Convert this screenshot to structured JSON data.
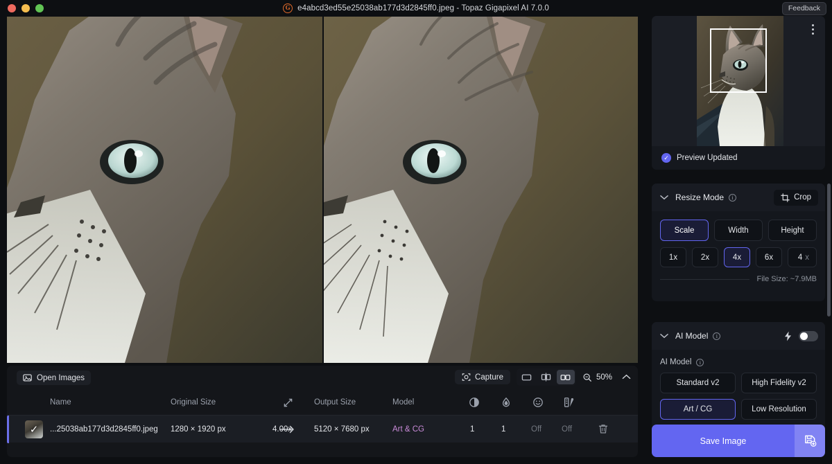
{
  "titlebar": {
    "filename": "e4abcd3ed55e25038ab177d3d2845ff0.jpeg",
    "title": "e4abcd3ed55e25038ab177d3d2845ff0.jpeg - Topaz Gigapixel AI 7.0.0",
    "app_logo": "G",
    "feedback_label": "Feedback",
    "traffic_lights": [
      "close-red",
      "minimize-yellow",
      "maximize-green"
    ]
  },
  "viewer": {
    "split_view": true,
    "left_pane": "original-preview",
    "right_pane": "upscaled-preview"
  },
  "bottom_toolbar": {
    "open_images_label": "Open Images",
    "capture_label": "Capture",
    "view_modes": [
      {
        "name": "single-view",
        "active": false
      },
      {
        "name": "split-view",
        "active": false
      },
      {
        "name": "side-by-side-view",
        "active": true
      }
    ],
    "zoom_level": "50%",
    "collapse_icon": "chevron-up-icon"
  },
  "table": {
    "columns": [
      "Name",
      "Original Size",
      "",
      "Output Size",
      "Model",
      "",
      "",
      "",
      ""
    ],
    "icon_columns": [
      "contrast-icon",
      "water-drop-icon",
      "face-recovery-icon",
      "color-palette-icon"
    ],
    "arrow_icon": "expand-arrow-icon",
    "rows": [
      {
        "selected": true,
        "checked": true,
        "name": "...25038ab177d3d2845ff0.jpeg",
        "original_size": "1280 × 1920 px",
        "scale": "4.00x",
        "output_size": "5120 × 7680 px",
        "model": "Art & CG",
        "contrast": "1",
        "denoise": "1",
        "face_recovery": "Off",
        "color": "Off",
        "delete_icon": "trash-icon"
      }
    ]
  },
  "preview_panel": {
    "status": "Preview Updated",
    "status_icon": "check-circle-icon",
    "menu_icon": "kebab-menu-icon",
    "crop_selection": true
  },
  "resize_mode": {
    "title": "Resize Mode",
    "info_icon": "info-icon",
    "chevron": "chevron-down-icon",
    "crop_button": "Crop",
    "crop_icon": "crop-icon",
    "modes": [
      {
        "label": "Scale",
        "selected": true
      },
      {
        "label": "Width",
        "selected": false
      },
      {
        "label": "Height",
        "selected": false
      }
    ],
    "scales": [
      {
        "label": "1x",
        "selected": false
      },
      {
        "label": "2x",
        "selected": false
      },
      {
        "label": "4x",
        "selected": true
      },
      {
        "label": "6x",
        "selected": false
      }
    ],
    "custom_value": "4",
    "custom_unit": "x",
    "file_size": "File Size: ~7.9MB"
  },
  "ai_model": {
    "title": "AI Model",
    "info_icon": "info-icon",
    "chevron": "chevron-down-icon",
    "lightning_icon": "lightning-bolt-icon",
    "toggle_on": false,
    "sub_label": "AI Model",
    "models": [
      {
        "label": "Standard v2",
        "selected": false
      },
      {
        "label": "High Fidelity v2",
        "selected": false
      },
      {
        "label": "Art / CG",
        "selected": true
      },
      {
        "label": "Low Resolution",
        "selected": false
      }
    ]
  },
  "save": {
    "label": "Save Image",
    "icon": "save-file-icon"
  },
  "colors": {
    "accent": "#6366f1",
    "accent_light": "#8183f3",
    "model_tag": "#c98bd8",
    "panel_bg": "#14171d",
    "app_bg": "#0d0f12"
  }
}
